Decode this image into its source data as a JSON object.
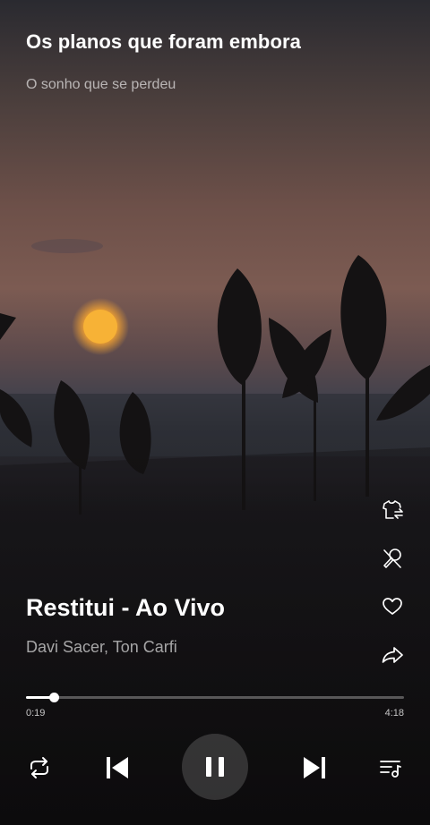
{
  "lyrics": {
    "current": "Os planos que foram embora",
    "next": "O sonho que se perdeu"
  },
  "track": {
    "title": "Restitui - Ao Vivo",
    "artist": "Davi Sacer, Ton Carfi"
  },
  "playback": {
    "elapsed": "0:19",
    "total": "4:18",
    "progress_fraction": 0.074,
    "state": "playing"
  },
  "icons": {
    "side": [
      "shirt-swap-icon",
      "mic-off-icon",
      "heart-icon",
      "share-icon"
    ],
    "controls": [
      "repeat-icon",
      "previous-icon",
      "pause-icon",
      "next-icon",
      "queue-icon"
    ]
  },
  "colors": {
    "primary_text": "#ffffff",
    "secondary_text": "#a6a09c",
    "sun": "#f5a623"
  }
}
